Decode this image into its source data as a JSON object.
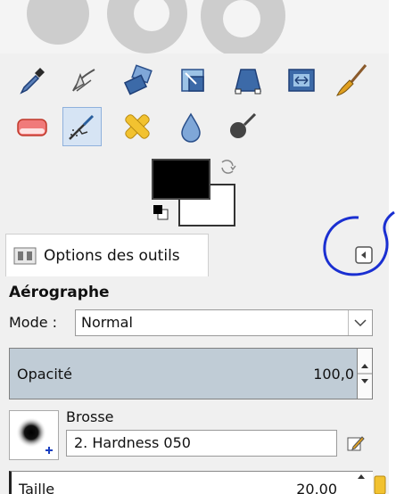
{
  "toolbox": {
    "row1": [
      "color-picker-icon",
      "paths-icon",
      "transform-icon",
      "crop-icon",
      "perspective-icon",
      "flip-icon",
      "paintbrush-icon"
    ],
    "row2": [
      "eraser-icon",
      "airbrush-icon",
      "heal-icon",
      "blur-icon",
      "smudge-icon"
    ],
    "active_tool": "airbrush-icon"
  },
  "colors": {
    "foreground": "#000000",
    "background": "#ffffff",
    "annotation": "#1a2fd1"
  },
  "tab": {
    "label": "Options des outils"
  },
  "tool_options": {
    "title": "Aérographe",
    "mode_label": "Mode :",
    "mode_value": "Normal",
    "opacity_label": "Opacité",
    "opacity_value": "100,0",
    "brush_label": "Brosse",
    "brush_value": "2. Hardness 050",
    "size_label": "Taille",
    "size_value": "20,00"
  }
}
